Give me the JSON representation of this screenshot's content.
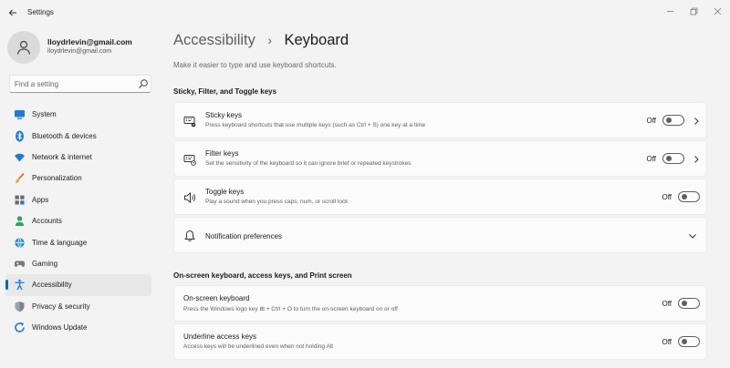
{
  "window": {
    "title": "Settings",
    "back_icon": "back-arrow-icon",
    "controls": [
      "minimize-icon",
      "restore-icon",
      "close-icon"
    ]
  },
  "user": {
    "name": "lloydrlevin@gmail.com",
    "email": "lloydrlevin@gmail.com"
  },
  "search": {
    "placeholder": "Find a setting",
    "value": ""
  },
  "sidebar": {
    "items": [
      {
        "label": "System",
        "icon": "monitor-icon",
        "active": false
      },
      {
        "label": "Bluetooth & devices",
        "icon": "bluetooth-icon",
        "active": false
      },
      {
        "label": "Network & internet",
        "icon": "wifi-icon",
        "active": false
      },
      {
        "label": "Personalization",
        "icon": "brush-icon",
        "active": false
      },
      {
        "label": "Apps",
        "icon": "apps-icon",
        "active": false
      },
      {
        "label": "Accounts",
        "icon": "person-icon",
        "active": false
      },
      {
        "label": "Time & language",
        "icon": "globe-clock-icon",
        "active": false
      },
      {
        "label": "Gaming",
        "icon": "gamepad-icon",
        "active": false
      },
      {
        "label": "Accessibility",
        "icon": "accessibility-icon",
        "active": true
      },
      {
        "label": "Privacy & security",
        "icon": "shield-icon",
        "active": false
      },
      {
        "label": "Windows Update",
        "icon": "update-icon",
        "active": false
      }
    ]
  },
  "main": {
    "breadcrumb_parent": "Accessibility",
    "breadcrumb_sep": "›",
    "breadcrumb_current": "Keyboard",
    "description": "Make it easier to type and use keyboard shortcuts.",
    "section1_title": "Sticky, Filter, and Toggle keys",
    "section2_title": "On-screen keyboard, access keys, and Print screen",
    "cards": [
      {
        "title": "Sticky keys",
        "desc": "Press keyboard shortcuts that use multiple keys (such as Ctrl + S) one key at a time",
        "state": "Off",
        "icon": "sticky-keys-icon",
        "has_chevron": true
      },
      {
        "title": "Filter keys",
        "desc": "Set the sensitivity of the keyboard so it can ignore brief or repeated keystrokes",
        "state": "Off",
        "icon": "filter-keys-icon",
        "has_chevron": true
      },
      {
        "title": "Toggle keys",
        "desc": "Play a sound when you press caps, num, or scroll lock",
        "state": "Off",
        "icon": "speaker-icon",
        "has_chevron": false
      },
      {
        "title": "Notification preferences",
        "icon": "bell-icon",
        "expander": true
      },
      {
        "title": "On-screen keyboard",
        "desc": "Press the Windows logo key ⊞ + Ctrl + O to turn the on-screen keyboard on or off",
        "state": "Off"
      },
      {
        "title": "Underline access keys",
        "desc": "Access keys will be underlined even when not holding Alt",
        "state": "Off"
      }
    ]
  },
  "colors": {
    "accent": "#0067c0",
    "background": "#f3f3f3",
    "card": "#fbfbfb",
    "toggle_off": "#5f5f5f"
  }
}
